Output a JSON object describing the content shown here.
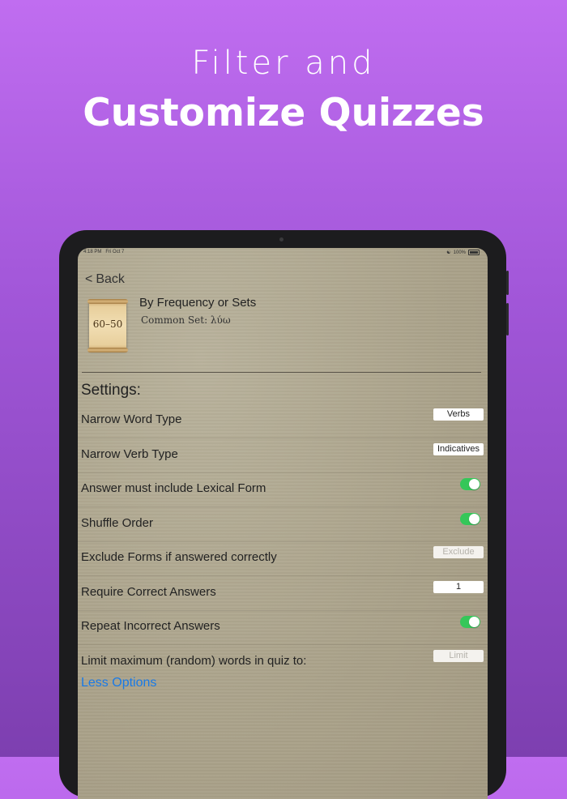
{
  "headline": {
    "line1": "Filter and",
    "line2": "Customize Quizzes"
  },
  "statusbar": {
    "time": "4:18 PM",
    "date": "Fri Oct 7",
    "battery": "100%"
  },
  "nav": {
    "back_label": "Back"
  },
  "quiz": {
    "thumbnail_text": "60–50",
    "title": "By Frequency or Sets",
    "subtitle": "Common Set: λύω"
  },
  "settings": {
    "header": "Settings:",
    "narrow_word_type": {
      "label": "Narrow Word Type",
      "value": "Verbs"
    },
    "narrow_verb_type": {
      "label": "Narrow Verb Type",
      "value": "Indicatives"
    },
    "lexical_form": {
      "label": "Answer must include Lexical Form",
      "on": true
    },
    "shuffle": {
      "label": "Shuffle Order",
      "on": true
    },
    "exclude_forms": {
      "label": "Exclude Forms if answered correctly",
      "placeholder": "Exclude"
    },
    "require_correct": {
      "label": "Require Correct Answers",
      "value": "1"
    },
    "repeat_incorrect": {
      "label": "Repeat Incorrect Answers",
      "on": true
    },
    "limit_words": {
      "label": "Limit maximum (random) words in quiz to:",
      "placeholder": "Limit"
    },
    "less_options": "Less Options"
  },
  "colors": {
    "accent_link": "#1a7ae6",
    "toggle_on": "#35c759",
    "background_top": "#c06df0",
    "background_bottom": "#7d3fb0"
  }
}
